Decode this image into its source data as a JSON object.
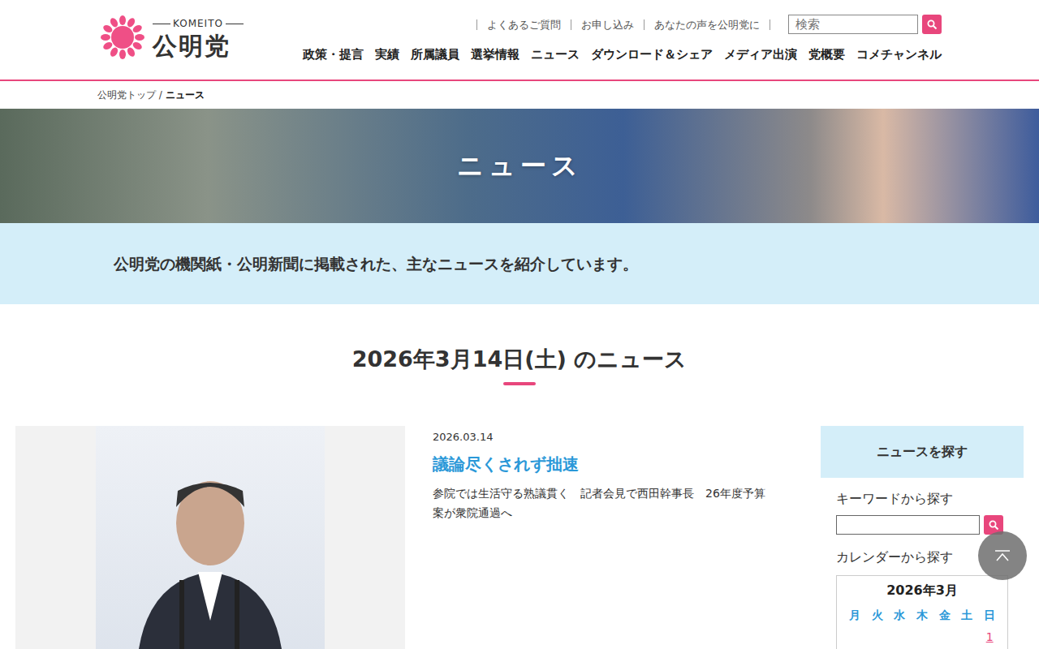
{
  "logo": {
    "sub": "KOMEITO",
    "main": "公明党"
  },
  "top_links": [
    "よくあるご質問",
    "お申し込み",
    "あなたの声を公明党に"
  ],
  "search": {
    "placeholder": "検索"
  },
  "nav": [
    "政策・提言",
    "実績",
    "所属議員",
    "選挙情報",
    "ニュース",
    "ダウンロード＆シェア",
    "メディア出演",
    "党概要",
    "コメチャンネル"
  ],
  "breadcrumb": {
    "home": "公明党トップ",
    "sep": " / ",
    "current": "ニュース"
  },
  "hero": {
    "title": "ニュース"
  },
  "intro": "公明党の機関紙・公明新聞に掲載された、主なニュースを紹介しています。",
  "day_heading": "2026年3月14日(土) のニュース",
  "articles": [
    {
      "date": "2026.03.14",
      "title": "議論尽くされず拙速",
      "summary": "参院では生活守る熟議貫く　記者会見で西田幹事長　26年度予算案が衆院通過へ"
    }
  ],
  "sidebar": {
    "title": "ニュースを探す",
    "keyword_label": "キーワードから探す",
    "calendar_label": "カレンダーから探す",
    "calendar": {
      "title": "2026年3月",
      "weekdays": [
        "月",
        "火",
        "水",
        "木",
        "金",
        "土",
        "日"
      ],
      "first_week": [
        "1"
      ]
    }
  }
}
